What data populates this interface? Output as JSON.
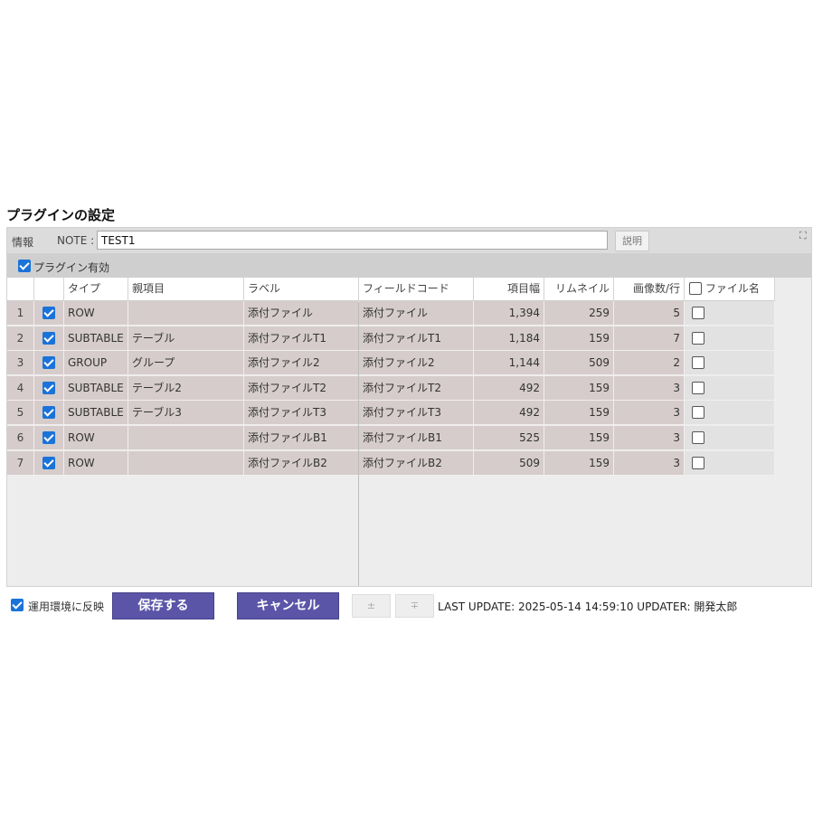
{
  "title": "プラグインの設定",
  "info": {
    "label": "情報",
    "note_label": "NOTE :",
    "note_value": "TEST1",
    "help_button": "説明",
    "expand_icon": "expand-icon"
  },
  "plugin_enabled_label": "プラグイン有効",
  "columns": {
    "type": "タイプ",
    "parent": "親項目",
    "label": "ラベル",
    "field_code": "フィールドコード",
    "width": "項目幅",
    "thumbnail": "リムネイル",
    "images_per_row": "画像数/行",
    "filename": "ファイル名"
  },
  "rows": [
    {
      "num": "1",
      "type": "ROW",
      "parent": "",
      "label": "添付ファイル",
      "field_code": "添付ファイル",
      "width": "1,394",
      "thumbnail": "259",
      "images_per_row": "5"
    },
    {
      "num": "2",
      "type": "SUBTABLE",
      "parent": "テーブル",
      "label": "添付ファイルT1",
      "field_code": "添付ファイルT1",
      "width": "1,184",
      "thumbnail": "159",
      "images_per_row": "7"
    },
    {
      "num": "3",
      "type": "GROUP",
      "parent": "グループ",
      "label": "添付ファイル2",
      "field_code": "添付ファイル2",
      "width": "1,144",
      "thumbnail": "509",
      "images_per_row": "2"
    },
    {
      "num": "4",
      "type": "SUBTABLE",
      "parent": "テーブル2",
      "label": "添付ファイルT2",
      "field_code": "添付ファイルT2",
      "width": "492",
      "thumbnail": "159",
      "images_per_row": "3"
    },
    {
      "num": "5",
      "type": "SUBTABLE",
      "parent": "テーブル3",
      "label": "添付ファイルT3",
      "field_code": "添付ファイルT3",
      "width": "492",
      "thumbnail": "159",
      "images_per_row": "3"
    },
    {
      "num": "6",
      "type": "ROW",
      "parent": "",
      "label": "添付ファイルB1",
      "field_code": "添付ファイルB1",
      "width": "525",
      "thumbnail": "159",
      "images_per_row": "3"
    },
    {
      "num": "7",
      "type": "ROW",
      "parent": "",
      "label": "添付ファイルB2",
      "field_code": "添付ファイルB2",
      "width": "509",
      "thumbnail": "159",
      "images_per_row": "3"
    }
  ],
  "footer": {
    "reflect_label": "運用環境に反映",
    "save_button": "保存する",
    "cancel_button": "キャンセル",
    "upload_icon": "±",
    "download_icon": "∓",
    "last_update": "LAST UPDATE: 2025-05-14 14:59:10 UPDATER: 開発太郎"
  },
  "colors": {
    "primary_button": "#5b55a8",
    "checkbox": "#1a73d9",
    "row_bg": "#d5cccb"
  }
}
